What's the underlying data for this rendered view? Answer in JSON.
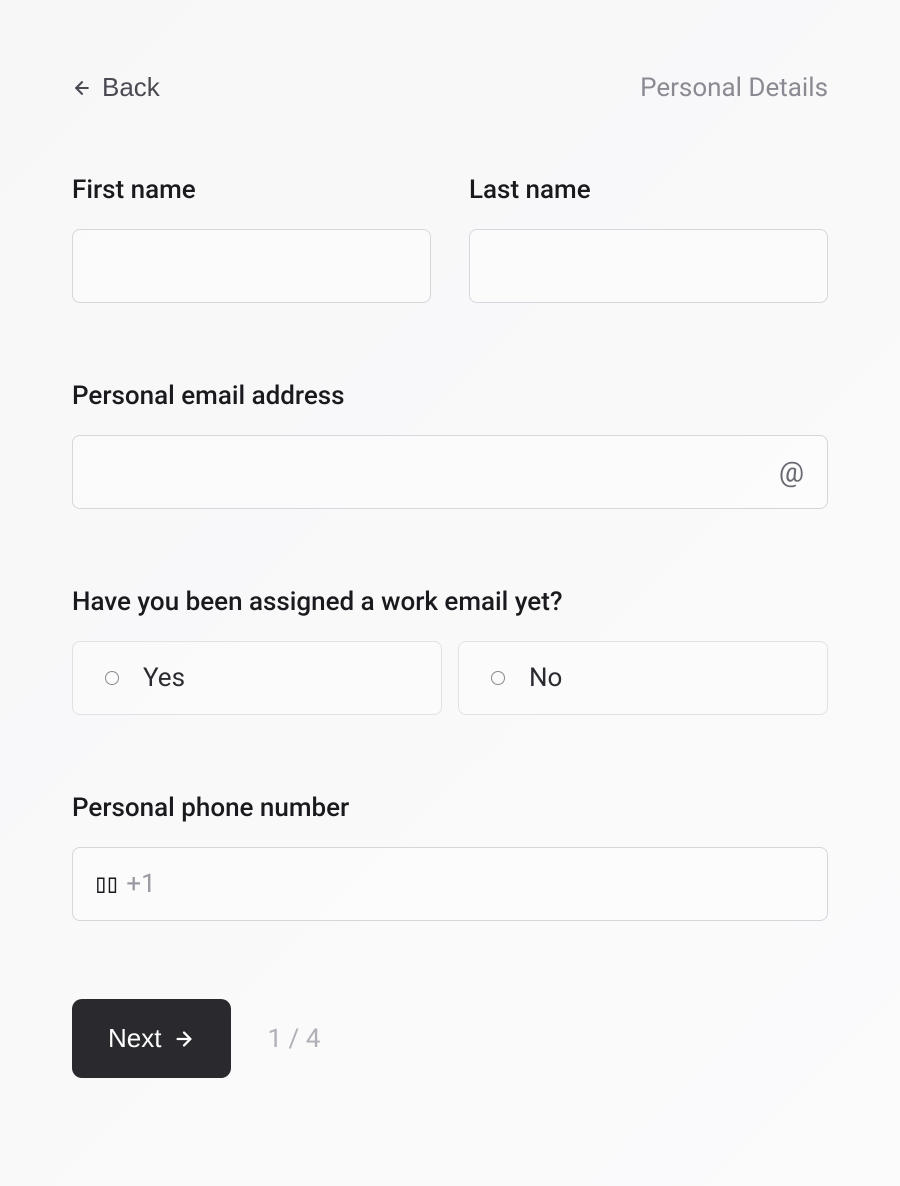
{
  "header": {
    "back_label": "Back",
    "page_title": "Personal Details"
  },
  "form": {
    "first_name": {
      "label": "First name",
      "value": ""
    },
    "last_name": {
      "label": "Last name",
      "value": ""
    },
    "personal_email": {
      "label": "Personal email address",
      "value": ""
    },
    "work_email_question": {
      "label": "Have you been assigned a work email yet?",
      "options": {
        "yes": "Yes",
        "no": "No"
      }
    },
    "phone": {
      "label": "Personal phone number",
      "prefix": "+1",
      "value": ""
    }
  },
  "footer": {
    "next_label": "Next",
    "page_indicator": "1 / 4"
  }
}
